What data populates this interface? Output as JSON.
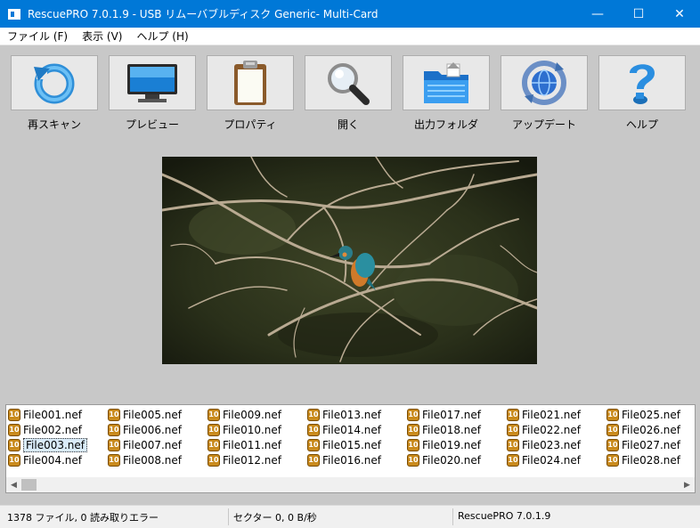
{
  "window": {
    "title": "RescuePRO 7.0.1.9 - USB リムーバブルディスク Generic- Multi-Card",
    "minimize": "—",
    "maximize": "☐",
    "close": "✕"
  },
  "menu": [
    {
      "label": "ファイル (F)"
    },
    {
      "label": "表示 (V)"
    },
    {
      "label": "ヘルプ (H)"
    }
  ],
  "toolbar": [
    {
      "label": "再スキャン",
      "icon": "rescan-icon"
    },
    {
      "label": "プレビュー",
      "icon": "monitor-icon"
    },
    {
      "label": "プロパティ",
      "icon": "clipboard-icon"
    },
    {
      "label": "開く",
      "icon": "magnifier-icon"
    },
    {
      "label": "出力フォルダ",
      "icon": "folder-icon"
    },
    {
      "label": "アップデート",
      "icon": "update-globe-icon"
    },
    {
      "label": "ヘルプ",
      "icon": "help-icon"
    }
  ],
  "files": {
    "icon_badge": "10",
    "selected": "File003.nef",
    "columns": [
      [
        "File001.nef",
        "File002.nef",
        "File003.nef",
        "File004.nef"
      ],
      [
        "File005.nef",
        "File006.nef",
        "File007.nef",
        "File008.nef"
      ],
      [
        "File009.nef",
        "File010.nef",
        "File011.nef",
        "File012.nef"
      ],
      [
        "File013.nef",
        "File014.nef",
        "File015.nef",
        "File016.nef"
      ],
      [
        "File017.nef",
        "File018.nef",
        "File019.nef",
        "File020.nef"
      ],
      [
        "File021.nef",
        "File022.nef",
        "File023.nef",
        "File024.nef"
      ],
      [
        "File025.nef",
        "File026.nef",
        "File027.nef",
        "File028.nef"
      ]
    ]
  },
  "status": {
    "files": "1378 ファイル, 0 読み取りエラー",
    "sector": "セクター 0, 0 B/秒",
    "version": "RescuePRO 7.0.1.9"
  },
  "colors": {
    "titlebar": "#0078d7",
    "file_icon": "#c98a1c"
  }
}
